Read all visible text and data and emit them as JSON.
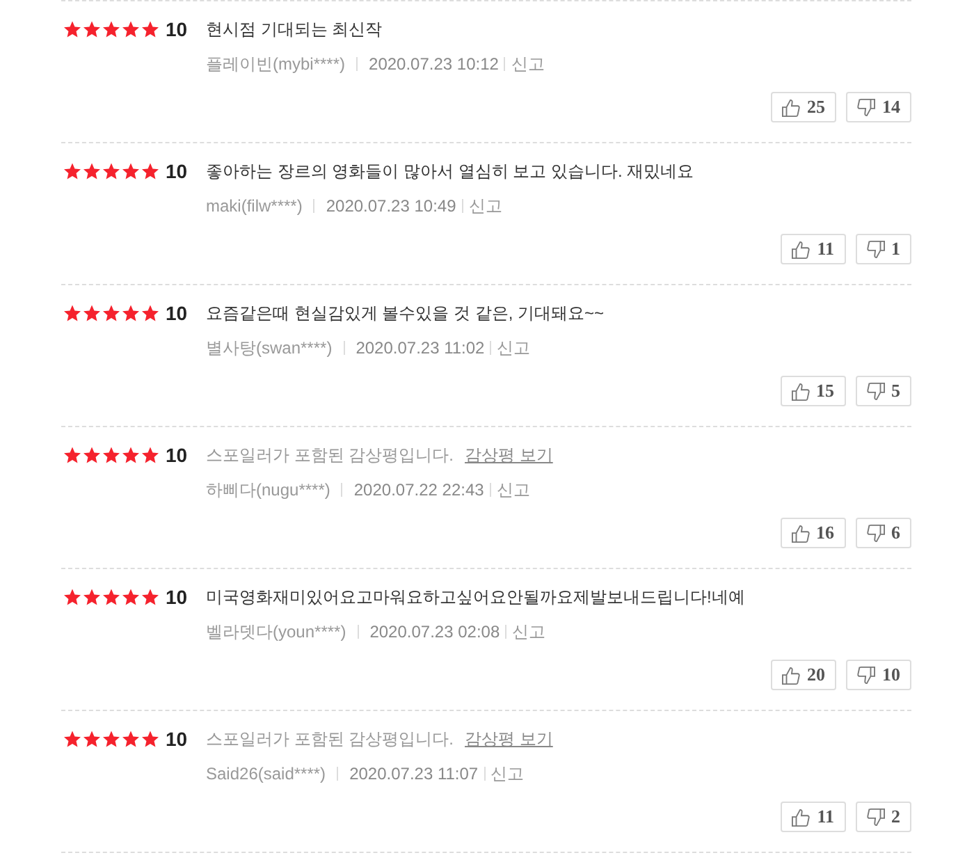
{
  "reviews": [
    {
      "kind": "text",
      "stars": 5,
      "score": "10",
      "text": "현시점 기대되는 최신작",
      "author": "플레이빈(mybi****)",
      "date": "2020.07.23 10:12",
      "report": "신고",
      "likes": "25",
      "dislikes": "14"
    },
    {
      "kind": "text",
      "stars": 5,
      "score": "10",
      "text": "좋아하는 장르의 영화들이 많아서 열심히 보고 있습니다. 재밌네요",
      "author": "maki(filw****)",
      "date": "2020.07.23 10:49",
      "report": "신고",
      "likes": "11",
      "dislikes": "1"
    },
    {
      "kind": "text",
      "stars": 5,
      "score": "10",
      "text": "요즘같은때 현실감있게 볼수있을 것 같은, 기대돼요~~",
      "author": "별사탕(swan****)",
      "date": "2020.07.23 11:02",
      "report": "신고",
      "likes": "15",
      "dislikes": "5"
    },
    {
      "kind": "spoiler",
      "stars": 5,
      "score": "10",
      "text": "스포일러가 포함된 감상평입니다.",
      "spoiler_link": "감상평 보기",
      "author": "하삐다(nugu****)",
      "date": "2020.07.22 22:43",
      "report": "신고",
      "likes": "16",
      "dislikes": "6"
    },
    {
      "kind": "text",
      "stars": 5,
      "score": "10",
      "text": "미국영화재미있어요고마워요하고싶어요안될까요제발보내드립니다!네예",
      "author": "벨라뎃다(youn****)",
      "date": "2020.07.23 02:08",
      "report": "신고",
      "likes": "20",
      "dislikes": "10"
    },
    {
      "kind": "spoiler",
      "stars": 5,
      "score": "10",
      "text": "스포일러가 포함된 감상평입니다.",
      "spoiler_link": "감상평 보기",
      "author": "Said26(said****)",
      "date": "2020.07.23 11:07",
      "report": "신고",
      "likes": "11",
      "dislikes": "2"
    }
  ]
}
